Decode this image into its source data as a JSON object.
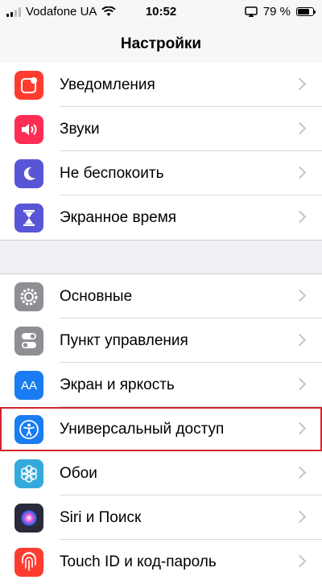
{
  "status_bar": {
    "carrier": "Vodafone UA",
    "time": "10:52",
    "battery_percent": "79 %",
    "battery_level": 0.79
  },
  "nav": {
    "title": "Настройки"
  },
  "group1": [
    {
      "label": "Уведомления",
      "icon": "notifications-icon",
      "color": "#ff3b30"
    },
    {
      "label": "Звуки",
      "icon": "speaker-icon",
      "color": "#ff2d55"
    },
    {
      "label": "Не беспокоить",
      "icon": "moon-icon",
      "color": "#5856d6"
    },
    {
      "label": "Экранное время",
      "icon": "hourglass-icon",
      "color": "#5856d6"
    }
  ],
  "group2": [
    {
      "label": "Основные",
      "icon": "gear-icon",
      "color": "#8e8e93"
    },
    {
      "label": "Пункт управления",
      "icon": "toggles-icon",
      "color": "#8e8e93"
    },
    {
      "label": "Экран и яркость",
      "icon": "text-size-icon",
      "color": "#1a7cf2",
      "icon_text": "AA"
    },
    {
      "label": "Универсальный доступ",
      "icon": "accessibility-icon",
      "color": "#1a7cf2",
      "highlighted": true
    },
    {
      "label": "Обои",
      "icon": "flower-icon",
      "color": "#34aadc"
    },
    {
      "label": "Siri и Поиск",
      "icon": "siri-icon",
      "color": "#2a2a3a"
    },
    {
      "label": "Touch ID и код-пароль",
      "icon": "fingerprint-icon",
      "color": "#ff3b30"
    }
  ]
}
